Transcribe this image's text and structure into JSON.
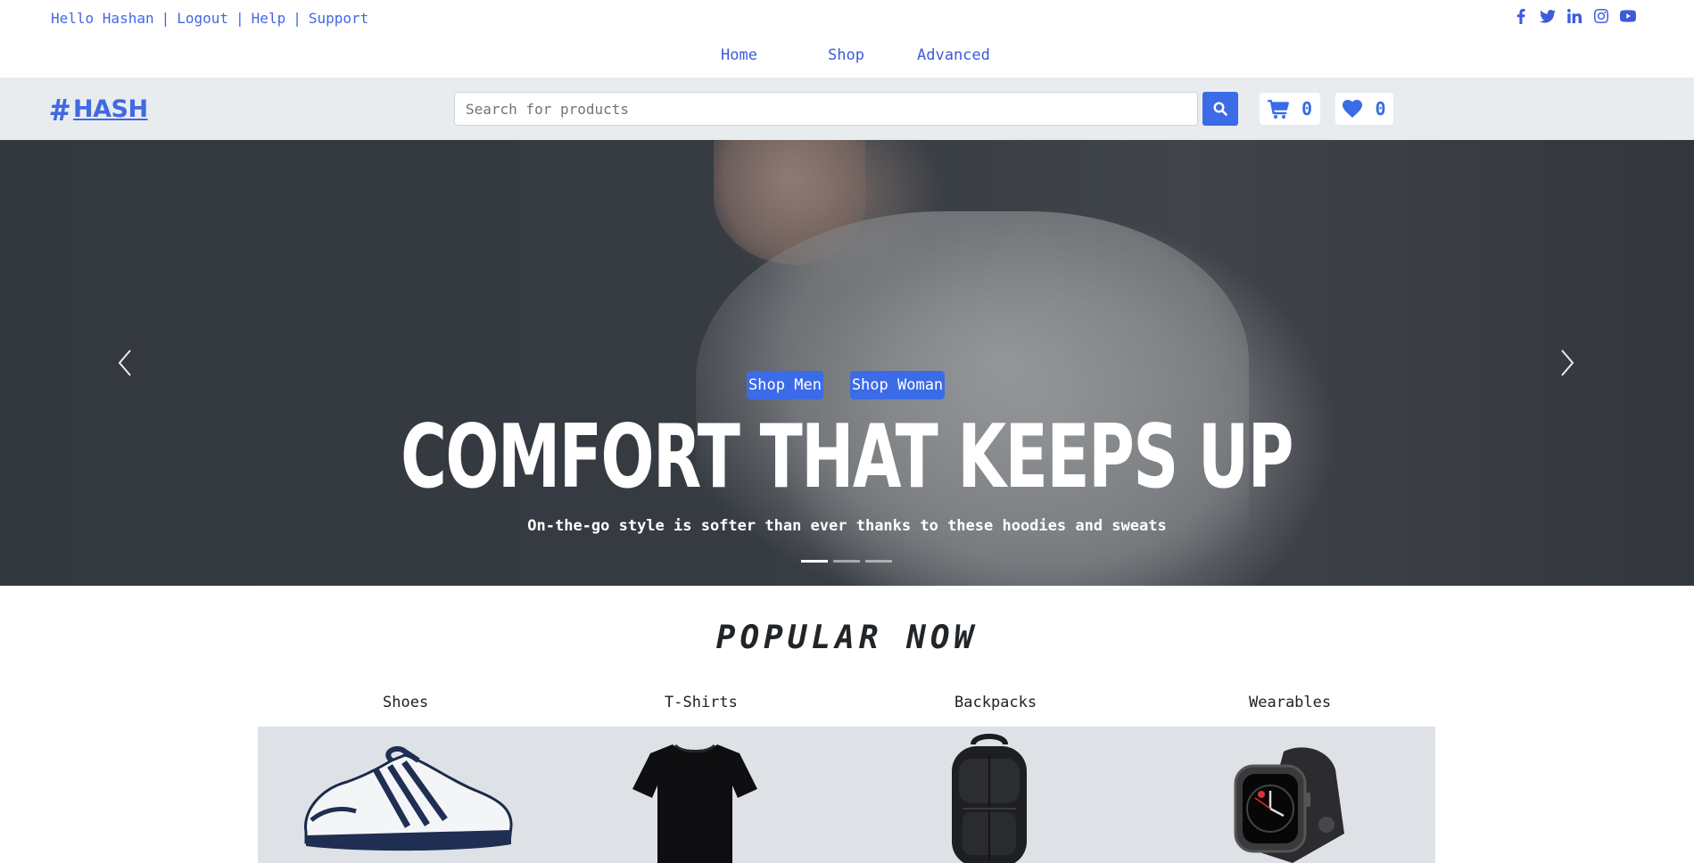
{
  "topbar": {
    "greeting": "Hello Hashan",
    "links": [
      "Logout",
      "Help",
      "Support"
    ],
    "separator": "|",
    "socials": [
      "facebook-icon",
      "twitter-icon",
      "linkedin-icon",
      "instagram-icon",
      "youtube-icon"
    ]
  },
  "nav": {
    "items": [
      "Home",
      "Shop",
      "Advanced"
    ]
  },
  "header": {
    "logo_text": "HASH",
    "logo_icon": "hashtag-icon",
    "search_placeholder": "Search for products",
    "cart_count": "0",
    "wishlist_count": "0"
  },
  "hero": {
    "buttons": [
      "Shop Men",
      "Shop Woman"
    ],
    "title": "COMFORT THAT KEEPS UP",
    "subtitle": "On-the-go style is softer than ever thanks to these hoodies and sweats",
    "slides": 3,
    "active_slide": 1
  },
  "popular": {
    "title": "POPULAR NOW",
    "categories": [
      "Shoes",
      "T-Shirts",
      "Backpacks",
      "Wearables"
    ],
    "products": [
      "shoe-image",
      "tshirt-image",
      "backpack-image",
      "smartwatch-image"
    ]
  },
  "colors": {
    "accent": "#3b6be6",
    "link": "#4169e1",
    "header_bg": "#e9ecef",
    "products_bg": "#dee2e6"
  }
}
